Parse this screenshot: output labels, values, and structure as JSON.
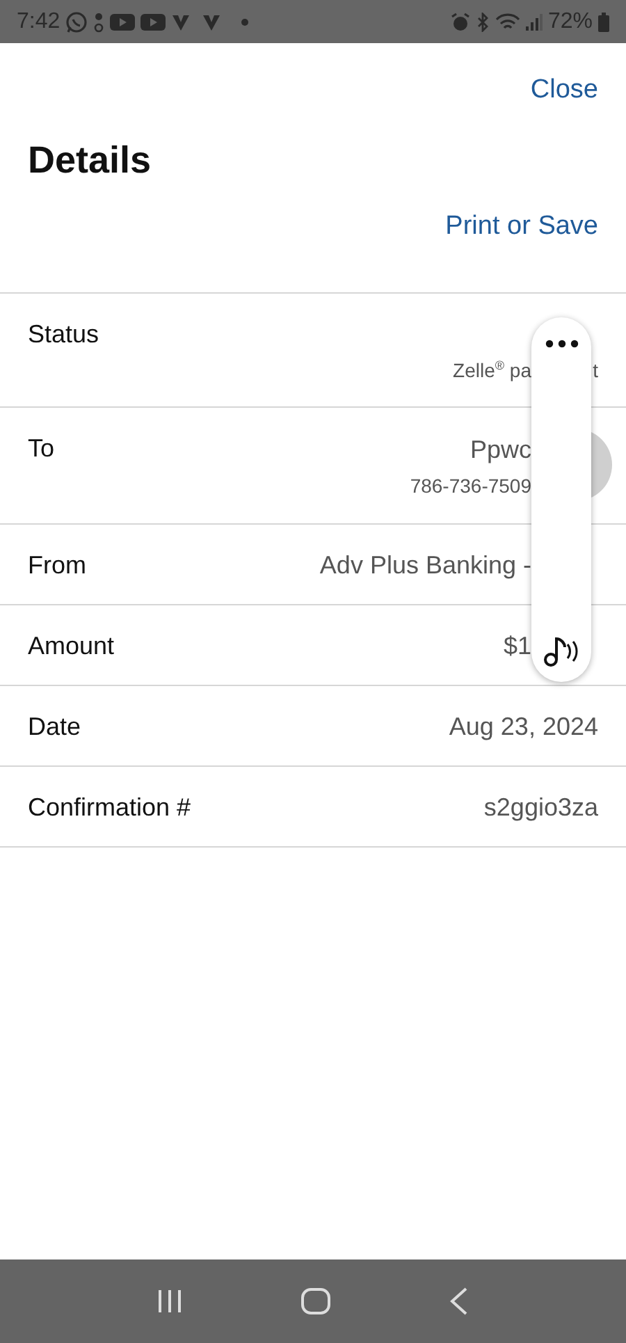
{
  "status_bar": {
    "time": "7:42",
    "battery": "72%"
  },
  "header": {
    "close": "Close",
    "title": "Details",
    "print": "Print or Save"
  },
  "rows": [
    {
      "label": "Status",
      "kind": "text",
      "lines": [
        {
          "kind": "note",
          "before": "Zelle$^{®}$ pa",
          "after": "t"
        }
      ]
    },
    {
      "label": "To",
      "kind": "contact",
      "lines": [
        {
          "kind": "main",
          "before": "Ppwc"
        },
        {
          "kind": "note",
          "before": "786-736-7509"
        }
      ]
    },
    {
      "label": "From",
      "kind": "text",
      "lines": [
        {
          "before": "Adv Plus Banking -"
        }
      ]
    },
    {
      "label": "Amount",
      "kind": "text",
      "lines": [
        {
          "before": "$1"
        }
      ]
    },
    {
      "label": "Date",
      "kind": "text",
      "lines": [
        {
          "text": "Aug 23, 2024"
        }
      ]
    },
    {
      "label": "Confirmation #",
      "kind": "text",
      "lines": [
        {
          "text": "s2ggio3za"
        }
      ]
    }
  ]
}
